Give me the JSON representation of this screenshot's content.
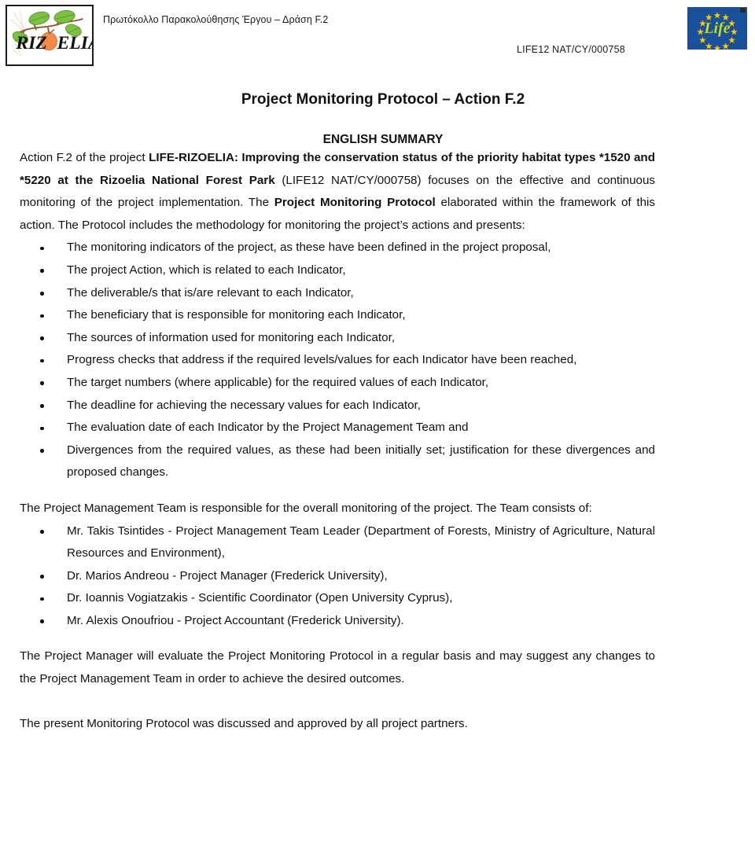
{
  "header": {
    "greek_title": "Πρωτόκολλο Παρακολούθησης Έργου – Δράση F.2",
    "life_code": "LIFE12 NAT/CY/000758",
    "rizoelia_logo_alt": "RIZOELIA",
    "rizoelia_text_left": "RIZ",
    "rizoelia_text_right": "ELIA",
    "life_logo_alt": "Life"
  },
  "document": {
    "title": "Project Monitoring Protocol – Action F.2",
    "subtitle": "ENGLISH SUMMARY",
    "intro": {
      "part1": "Action F.2 of the project ",
      "bold1": "LIFE-RIZOELIA: Improving the conservation status of the priority habitat types *1520 and *5220 at the Rizoelia National Forest Park",
      "part2": " (LIFE12 NAT/CY/000758) focuses on the effective and continuous monitoring of the project implementation. The ",
      "bold2": "Project Monitoring Protocol",
      "part3": " elaborated within the framework of this action. The Protocol includes the methodology for monitoring the project’s actions and presents:"
    },
    "protocol_items": [
      "The monitoring indicators of the project, as these have been defined in the project proposal,",
      "The project Action, which is related to each Indicator,",
      "The deliverable/s that is/are relevant to each Indicator,",
      "The beneficiary that is responsible for monitoring each Indicator,",
      "The sources of information used for monitoring each Indicator,",
      "Progress checks that address if the required levels/values for each Indicator have been reached,",
      "The target numbers (where applicable) for the required values of each Indicator,",
      "The deadline for achieving the necessary values for each Indicator,",
      "The evaluation date of each Indicator by the Project Management Team and",
      "Divergences from the required values, as these had been initially set; justification for these divergences and proposed changes."
    ],
    "team_intro": "The Project Management Team is responsible for the overall monitoring of the project. The Team consists of:",
    "team_members": [
      "Mr. Takis Tsintides - Project Management Team Leader (Department of Forests, Ministry of Agriculture, Natural Resources and Environment),",
      "Dr. Marios Andreou - Project Manager (Frederick University),",
      "Dr. Ioannis Vogiatzakis - Scientific Coordinator (Open University Cyprus),",
      "Mr. Alexis Onoufriou - Project Accountant (Frederick University)."
    ],
    "closing_para_1": "The Project Manager will evaluate the Project Monitoring Protocol in a regular basis and may suggest any changes to the Project Management Team in order to achieve the desired outcomes.",
    "closing_para_2": "The present Monitoring Protocol was discussed and approved by all project partners."
  },
  "colors": {
    "life_blue": "#1a4f9c",
    "life_star_yellow": "#ffcc00",
    "life_script_green": "#c8e04a",
    "leaf_green": "#7dc242",
    "fruit_orange": "#f08b4a",
    "text_black": "#111111"
  }
}
